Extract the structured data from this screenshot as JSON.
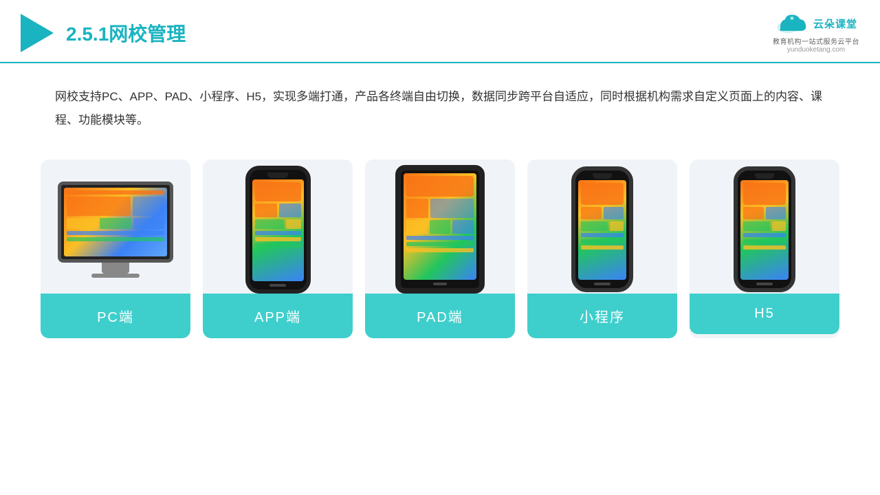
{
  "header": {
    "title_prefix": "2.5.1",
    "title_main": "网校管理",
    "brand_name": "云朵课堂",
    "brand_url": "yunduoketang.com",
    "brand_subtitle": "教育机构一站\n式服务云平台"
  },
  "description": {
    "text": "网校支持PC、APP、PAD、小程序、H5，实现多端打通，产品各终端自由切换，数据同步跨平台自适应，同时根据机构需求自定义页面上的内容、课程、功能模块等。"
  },
  "cards": [
    {
      "id": "pc",
      "label": "PC端"
    },
    {
      "id": "app",
      "label": "APP端"
    },
    {
      "id": "pad",
      "label": "PAD端"
    },
    {
      "id": "miniprogram",
      "label": "小程序"
    },
    {
      "id": "h5",
      "label": "H5"
    }
  ]
}
